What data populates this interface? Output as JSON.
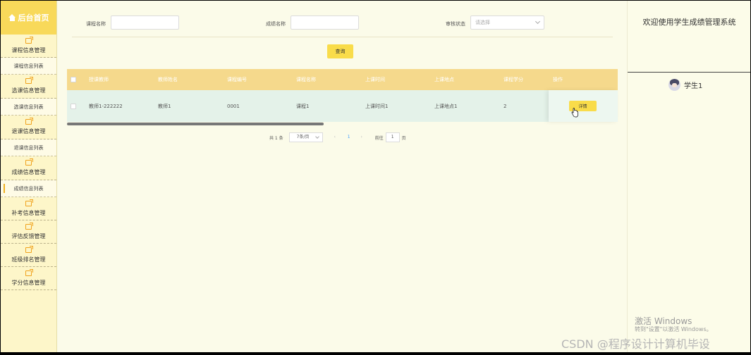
{
  "sidebar": {
    "brand": "后台首页",
    "groups": [
      {
        "label": "课程信息管理",
        "sub": "课程信息列表"
      },
      {
        "label": "选课信息管理",
        "sub": "选课信息列表"
      },
      {
        "label": "退课信息管理",
        "sub": "退课信息列表"
      },
      {
        "label": "成绩信息管理",
        "sub": "成绩信息列表"
      },
      {
        "label": "补考信息管理",
        "sub": ""
      },
      {
        "label": "评估反馈管理",
        "sub": ""
      },
      {
        "label": "班级排名管理",
        "sub": ""
      },
      {
        "label": "学分信息管理",
        "sub": ""
      }
    ]
  },
  "filters": {
    "course_name_label": "课程名称",
    "grade_name_label": "成绩名称",
    "review_status_label": "审核状态",
    "review_status_placeholder": "请选择",
    "search_button": "查询"
  },
  "table": {
    "headers": [
      "授课教师",
      "教师姓名",
      "课程编号",
      "课程名称",
      "上课时间",
      "上课地点",
      "课程学分",
      "操作"
    ],
    "rows": [
      {
        "cells": [
          "教师1-222222",
          "教师1",
          "0001",
          "课程1",
          "上课时间1",
          "上课地点1",
          "2"
        ],
        "action": "详情"
      }
    ]
  },
  "pagination": {
    "total": "共 1 条",
    "page_size": "7条/页",
    "prev": "‹",
    "current_page": "1",
    "next": "›",
    "goto_label": "前往",
    "goto_value": "1",
    "goto_suffix": "页"
  },
  "right_panel": {
    "welcome": "欢迎使用学生成绩管理系统",
    "user_name": "学生1"
  },
  "watermark": {
    "line1": "激活 Windows",
    "line2": "转到\"设置\"以激活 Windows。",
    "csdn": "CSDN @程序设计计算机毕设"
  }
}
